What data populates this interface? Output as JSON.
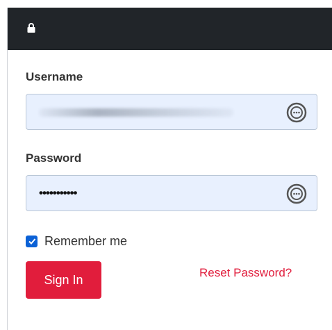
{
  "form": {
    "username_label": "Username",
    "password_label": "Password",
    "password_value": "•••••••••••",
    "remember_label": "Remember me",
    "remember_checked": true,
    "signin_label": "Sign In",
    "reset_label": "Reset Password?"
  },
  "icons": {
    "header": "lock-icon",
    "fields": "password-manager-icon",
    "checkbox": "checkmark-icon"
  },
  "colors": {
    "header_bg": "#212529",
    "field_bg": "#e8f0fe",
    "accent": "#e11d3c",
    "checkbox": "#0b61d6"
  }
}
